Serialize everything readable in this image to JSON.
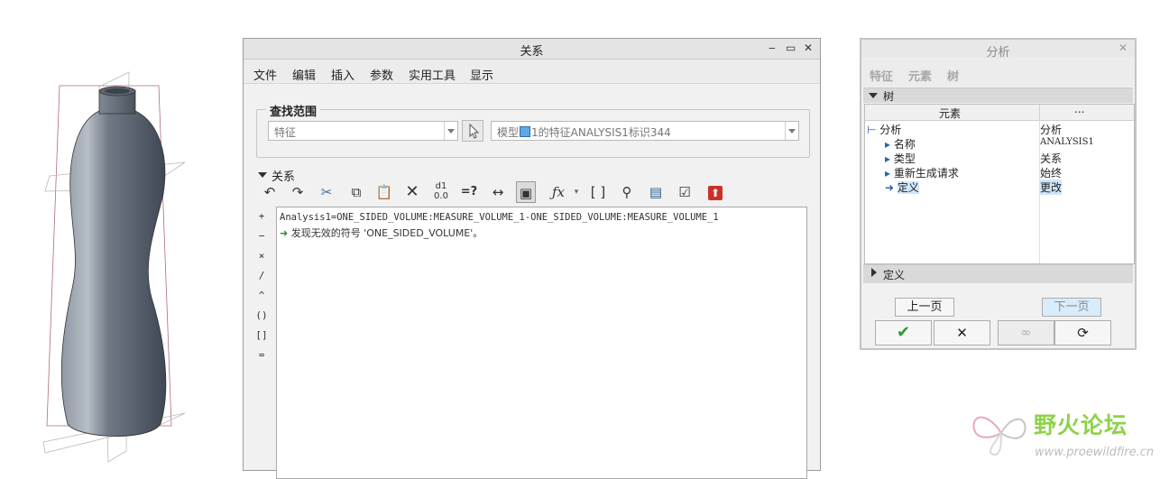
{
  "relations_dialog": {
    "title": "关系",
    "menu": [
      "文件",
      "编辑",
      "插入",
      "参数",
      "实用工具",
      "显示"
    ],
    "lookup": {
      "legend": "查找范围",
      "type_value": "特征",
      "context_prefix": "模型",
      "context_value": "1的特征ANALYSIS1标识344"
    },
    "relations_section": "关系",
    "operators": [
      "+",
      "−",
      "×",
      "/",
      "^",
      "()",
      "[]",
      "="
    ],
    "editor_lines": [
      "Analysis1=ONE_SIDED_VOLUME:MEASURE_VOLUME_1-ONE_SIDED_VOLUME:MEASURE_VOLUME_1"
    ],
    "error_message": "发现无效的符号 'ONE_SIDED_VOLUME'。"
  },
  "analysis_dialog": {
    "title": "分析",
    "tabs": [
      "特征",
      "元素",
      "树"
    ],
    "tree_section": "树",
    "columns": [
      "元素",
      "..."
    ],
    "rows": [
      {
        "name": "分析",
        "value": "分析"
      },
      {
        "name": "名称",
        "value": "ANALYSIS1"
      },
      {
        "name": "类型",
        "value": "关系"
      },
      {
        "name": "重新生成请求",
        "value": "始终"
      },
      {
        "name": "定义",
        "value": "更改"
      }
    ],
    "define_section": "定义",
    "prev_label": "上一页",
    "next_label": "下一页"
  },
  "watermark": {
    "brand": "野火论坛",
    "url": "www.proewildfire.cn"
  },
  "colors": {
    "green_arrow": "#2e8b2e",
    "selection": "#cfe6fb",
    "model_shade": "#7d8794"
  }
}
